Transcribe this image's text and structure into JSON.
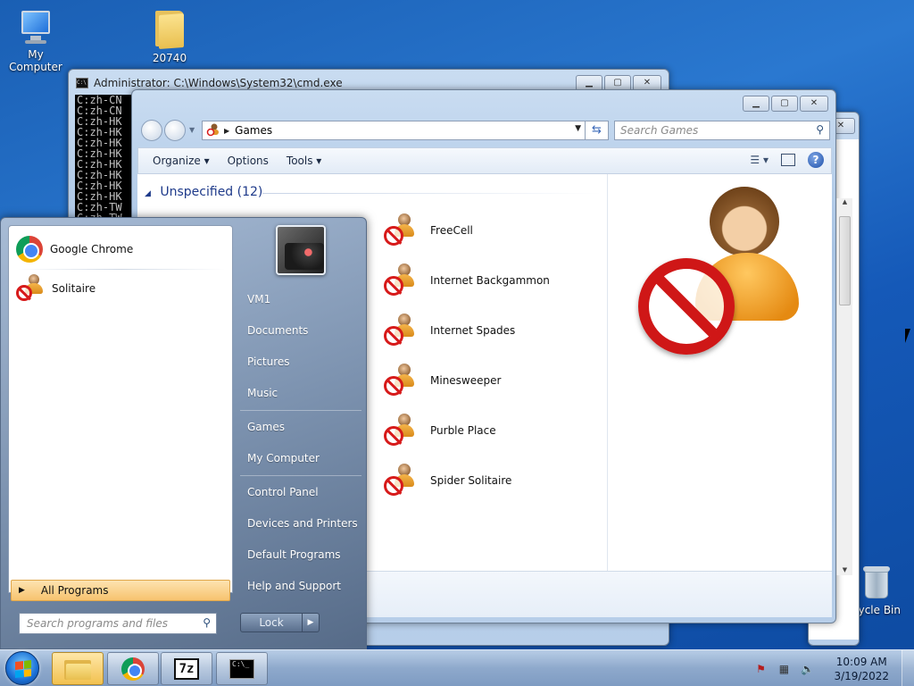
{
  "desktop": {
    "icons": [
      {
        "label": "My Computer",
        "icon": "computer-icon"
      },
      {
        "label": "20740",
        "icon": "folder-icon"
      },
      {
        "label": "cycle Bin",
        "icon": "recycle-bin-icon"
      }
    ]
  },
  "cmd_window": {
    "title": "Administrator: C:\\Windows\\System32\\cmd.exe",
    "lines": [
      "C:zh-CN",
      "C:zh-CN",
      "C:zh-HK",
      "C:zh-HK",
      "C:zh-HK",
      "C:zh-HK",
      "C:zh-HK",
      "C:zh-HK",
      "C:zh-HK",
      "C:zh-HK",
      "C:zh-TW",
      "C:zh-TW"
    ]
  },
  "games_window": {
    "address": {
      "breadcrumb": "Games"
    },
    "search": {
      "placeholder": "Search Games"
    },
    "toolbar": {
      "organize": "Organize",
      "options": "Options",
      "tools": "Tools"
    },
    "group": {
      "header": "Unspecified (12)"
    },
    "items": [
      "FreeCell",
      "Internet Backgammon",
      "Internet Spades",
      "Minesweeper",
      "Purble Place",
      "Spider Solitaire"
    ]
  },
  "start_menu": {
    "pinned": [
      {
        "label": "Google Chrome",
        "icon": "chrome-icon"
      },
      {
        "label": "Solitaire",
        "icon": "solitaire-icon"
      }
    ],
    "all_programs": "All Programs",
    "search_placeholder": "Search programs and files",
    "right_items": [
      "VM1",
      "Documents",
      "Pictures",
      "Music",
      "Games",
      "My Computer",
      "Control Panel",
      "Devices and Printers",
      "Default Programs",
      "Help and Support"
    ],
    "lock_label": "Lock"
  },
  "taskbar": {
    "buttons": [
      "windows-explorer",
      "google-chrome",
      "7-zip",
      "command-prompt"
    ],
    "clock": {
      "time": "10:09 AM",
      "date": "3/19/2022"
    }
  }
}
